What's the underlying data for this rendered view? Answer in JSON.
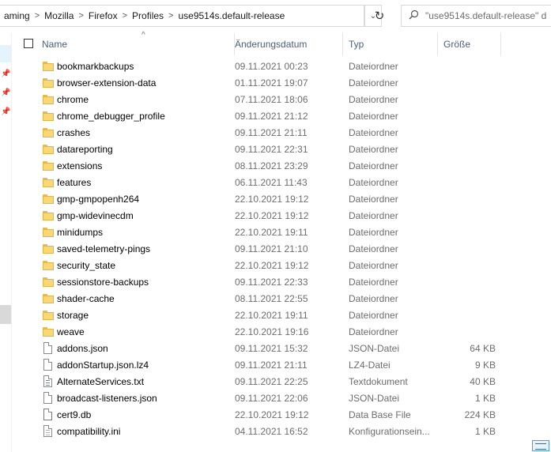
{
  "address_bar": {
    "crumbs": [
      "aming",
      "Mozilla",
      "Firefox",
      "Profiles",
      "use9514s.default-release"
    ],
    "separator": ">",
    "dropdown_icon": "chevron-down-icon",
    "refresh_icon": "refresh-icon"
  },
  "search": {
    "placeholder": "\"use9514s.default-release\" d",
    "icon": "search-icon"
  },
  "columns": {
    "name": "Name",
    "date": "Änderungsdatum",
    "type": "Typ",
    "size": "Größe",
    "sort_indicator": "^"
  },
  "files": [
    {
      "name": "bookmarkbackups",
      "date": "09.11.2021 00:23",
      "type": "Dateiordner",
      "size": "",
      "kind": "folder"
    },
    {
      "name": "browser-extension-data",
      "date": "01.11.2021 19:07",
      "type": "Dateiordner",
      "size": "",
      "kind": "folder"
    },
    {
      "name": "chrome",
      "date": "07.11.2021 18:06",
      "type": "Dateiordner",
      "size": "",
      "kind": "folder"
    },
    {
      "name": "chrome_debugger_profile",
      "date": "09.11.2021 21:12",
      "type": "Dateiordner",
      "size": "",
      "kind": "folder"
    },
    {
      "name": "crashes",
      "date": "09.11.2021 21:11",
      "type": "Dateiordner",
      "size": "",
      "kind": "folder"
    },
    {
      "name": "datareporting",
      "date": "09.11.2021 22:31",
      "type": "Dateiordner",
      "size": "",
      "kind": "folder"
    },
    {
      "name": "extensions",
      "date": "08.11.2021 23:29",
      "type": "Dateiordner",
      "size": "",
      "kind": "folder"
    },
    {
      "name": "features",
      "date": "06.11.2021 11:43",
      "type": "Dateiordner",
      "size": "",
      "kind": "folder"
    },
    {
      "name": "gmp-gmpopenh264",
      "date": "22.10.2021 19:12",
      "type": "Dateiordner",
      "size": "",
      "kind": "folder"
    },
    {
      "name": "gmp-widevinecdm",
      "date": "22.10.2021 19:12",
      "type": "Dateiordner",
      "size": "",
      "kind": "folder"
    },
    {
      "name": "minidumps",
      "date": "22.10.2021 19:11",
      "type": "Dateiordner",
      "size": "",
      "kind": "folder"
    },
    {
      "name": "saved-telemetry-pings",
      "date": "09.11.2021 21:10",
      "type": "Dateiordner",
      "size": "",
      "kind": "folder"
    },
    {
      "name": "security_state",
      "date": "22.10.2021 19:12",
      "type": "Dateiordner",
      "size": "",
      "kind": "folder"
    },
    {
      "name": "sessionstore-backups",
      "date": "09.11.2021 22:33",
      "type": "Dateiordner",
      "size": "",
      "kind": "folder"
    },
    {
      "name": "shader-cache",
      "date": "08.11.2021 22:55",
      "type": "Dateiordner",
      "size": "",
      "kind": "folder"
    },
    {
      "name": "storage",
      "date": "22.10.2021 19:11",
      "type": "Dateiordner",
      "size": "",
      "kind": "folder"
    },
    {
      "name": "weave",
      "date": "22.10.2021 19:16",
      "type": "Dateiordner",
      "size": "",
      "kind": "folder"
    },
    {
      "name": "addons.json",
      "date": "09.11.2021 15:32",
      "type": "JSON-Datei",
      "size": "64 KB",
      "kind": "file"
    },
    {
      "name": "addonStartup.json.lz4",
      "date": "09.11.2021 21:11",
      "type": "LZ4-Datei",
      "size": "9 KB",
      "kind": "file"
    },
    {
      "name": "AlternateServices.txt",
      "date": "09.11.2021 22:25",
      "type": "Textdokument",
      "size": "40 KB",
      "kind": "txt"
    },
    {
      "name": "broadcast-listeners.json",
      "date": "09.11.2021 22:06",
      "type": "JSON-Datei",
      "size": "1 KB",
      "kind": "file"
    },
    {
      "name": "cert9.db",
      "date": "22.10.2021 19:12",
      "type": "Data Base File",
      "size": "224 KB",
      "kind": "db"
    },
    {
      "name": "compatibility.ini",
      "date": "04.11.2021 16:52",
      "type": "Konfigurationsein...",
      "size": "1 KB",
      "kind": "ini"
    }
  ],
  "colors": {
    "header_text": "#4c607a",
    "secondary_text": "#6d6d6d",
    "folder_yellow": "#f8d775",
    "nav_selected": "#e5f3ff"
  }
}
